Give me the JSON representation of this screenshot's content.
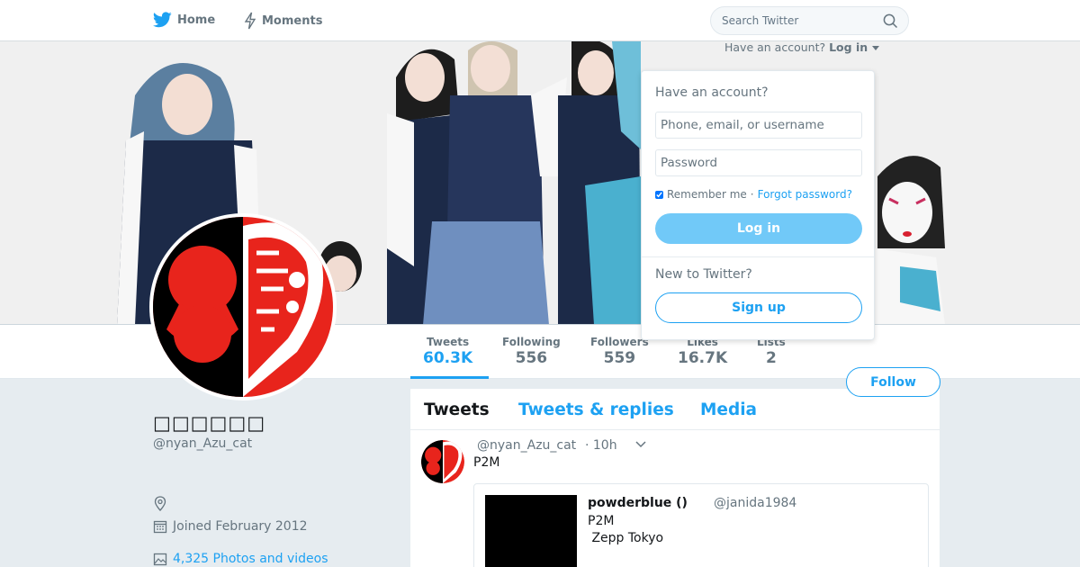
{
  "nav": {
    "home_label": "Home",
    "moments_label": "Moments",
    "search_placeholder": "Search Twitter"
  },
  "login_prompt": {
    "have_account": "Have an account?",
    "login_link": "Log in"
  },
  "login_dropdown": {
    "title": "Have an account?",
    "username_placeholder": "Phone, email, or username",
    "password_placeholder": "Password",
    "remember_label": "Remember me",
    "separator": "·",
    "forgot_label": "Forgot password?",
    "login_button": "Log in",
    "new_to_twitter": "New to Twitter?",
    "signup_button": "Sign up"
  },
  "stats": [
    {
      "label": "Tweets",
      "value": "60.3K"
    },
    {
      "label": "Following",
      "value": "556"
    },
    {
      "label": "Followers",
      "value": "559"
    },
    {
      "label": "Likes",
      "value": "16.7K"
    },
    {
      "label": "Lists",
      "value": "2"
    }
  ],
  "follow_button": "Follow",
  "profile": {
    "display_name": "□□□□□□",
    "handle": "@nyan_Azu_cat",
    "joined": "Joined February 2012",
    "photos_link": "4,325 Photos and videos"
  },
  "timeline": {
    "tabs": [
      "Tweets",
      "Tweets & replies",
      "Media"
    ],
    "tweet": {
      "handle": "@nyan_Azu_cat",
      "time": "· 10h",
      "text": "P2M",
      "quote": {
        "name": "powderblue ()",
        "handle": "@janida1984",
        "line1": "P2M",
        "line2": " Zepp Tokyo"
      }
    }
  },
  "colors": {
    "accent": "#1da1f2",
    "login_button_bg": "#71c9f8",
    "page_bg": "#e6ecf0",
    "avatar_red": "#e8241c"
  }
}
